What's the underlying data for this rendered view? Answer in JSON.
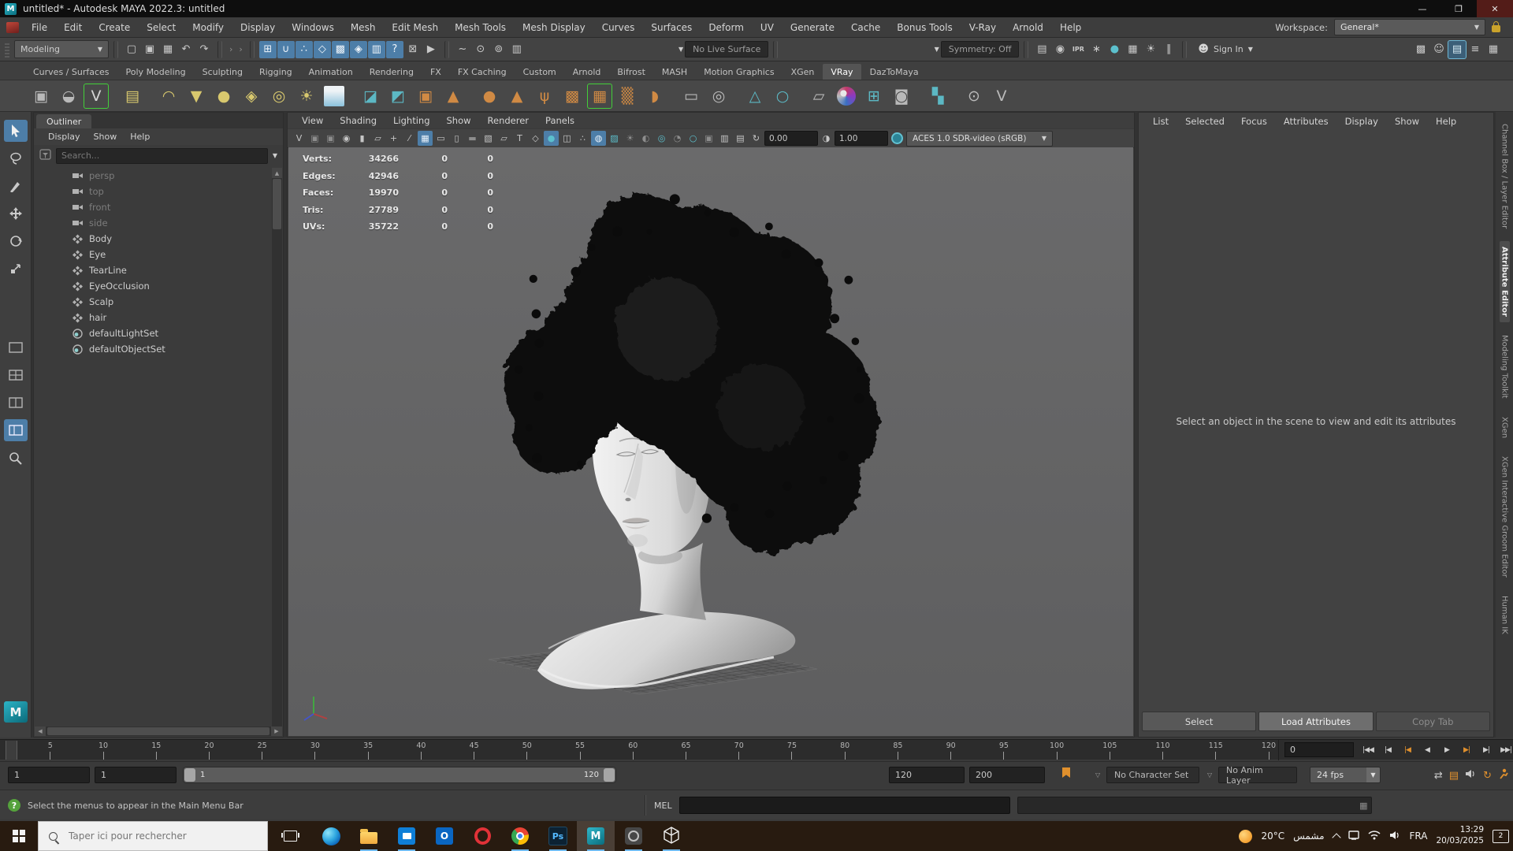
{
  "colors": {
    "highlight": "#4d7ea8",
    "accent_orange": "#e0902d",
    "teal": "#5cc0cd",
    "shelf_yellow": "#d8c86e",
    "shelf_orange": "#d08a44",
    "icon_gray": "#b9b9b9",
    "viewport_bg": "#646464"
  },
  "window": {
    "title": "untitled* - Autodesk MAYA 2022.3: untitled",
    "logo_letter": "M",
    "minimize_glyph": "—",
    "maximize_glyph": "❐",
    "close_glyph": "✕"
  },
  "menubar": {
    "items": [
      {
        "label": "File"
      },
      {
        "label": "Edit"
      },
      {
        "label": "Create"
      },
      {
        "label": "Select"
      },
      {
        "label": "Modify"
      },
      {
        "label": "Display"
      },
      {
        "label": "Windows"
      },
      {
        "label": "Mesh"
      },
      {
        "label": "Edit Mesh"
      },
      {
        "label": "Mesh Tools"
      },
      {
        "label": "Mesh Display"
      },
      {
        "label": "Curves"
      },
      {
        "label": "Surfaces"
      },
      {
        "label": "Deform"
      },
      {
        "label": "UV"
      },
      {
        "label": "Generate"
      },
      {
        "label": "Cache"
      },
      {
        "label": "Bonus Tools"
      },
      {
        "label": "V-Ray"
      },
      {
        "label": "Arnold"
      },
      {
        "label": "Help"
      }
    ],
    "workspace_label": "Workspace:",
    "workspace_value": "General*"
  },
  "statusline": {
    "mode": "Modeling",
    "file_icons": [
      {
        "name": "new-scene-icon",
        "glyph": "▢"
      },
      {
        "name": "open-scene-icon",
        "glyph": "▣"
      },
      {
        "name": "save-scene-icon",
        "glyph": "▦"
      },
      {
        "name": "undo-icon",
        "glyph": "↶"
      },
      {
        "name": "redo-icon",
        "glyph": "↷"
      }
    ],
    "snap_icons": [
      {
        "name": "snap-grid-icon",
        "glyph": "⊞",
        "cls": "hl"
      },
      {
        "name": "snap-curve-icon",
        "glyph": "∪",
        "cls": "hl"
      },
      {
        "name": "snap-point-icon",
        "glyph": "∴",
        "cls": "hl"
      },
      {
        "name": "snap-projected-center-icon",
        "glyph": "◇",
        "cls": "hl"
      },
      {
        "name": "snap-view-plane-icon",
        "glyph": "▩",
        "cls": "hl"
      },
      {
        "name": "make-live-icon",
        "glyph": "◈",
        "cls": "hl"
      },
      {
        "name": "snap-magnet-icon",
        "glyph": "▥",
        "cls": "hl"
      },
      {
        "name": "snap-help-icon",
        "glyph": "?",
        "cls": "hl"
      },
      {
        "name": "modeling-lock-icon",
        "glyph": "⊠"
      },
      {
        "name": "highlight-selection-icon",
        "glyph": "▶"
      }
    ],
    "history_icons": [
      {
        "name": "input-operations-icon",
        "glyph": "~"
      },
      {
        "name": "output-operations-icon",
        "glyph": "⊙"
      },
      {
        "name": "construction-history-icon",
        "glyph": "⊚"
      },
      {
        "name": "history-list-icon",
        "glyph": "▥"
      }
    ],
    "no_live_surface": "No Live Surface",
    "symmetry": "Symmetry: Off",
    "render_icons": [
      {
        "name": "open-render-view-icon",
        "glyph": "▤"
      },
      {
        "name": "render-current-frame-icon",
        "glyph": "◉"
      },
      {
        "name": "ipr-render-icon",
        "glyph": "IPR",
        "cls": "small"
      },
      {
        "name": "render-settings-icon",
        "glyph": "∗"
      },
      {
        "name": "toon-shading-icon",
        "glyph": "●",
        "cls": "teal"
      },
      {
        "name": "render-setup-icon",
        "glyph": "▦"
      },
      {
        "name": "light-editor-icon",
        "glyph": "☀"
      },
      {
        "name": "pause-viewport-icon",
        "glyph": "∥"
      }
    ],
    "sign_in": "Sign In",
    "sidebar_icons": [
      {
        "name": "modeling-toolkit-toggle-icon",
        "glyph": "▩"
      },
      {
        "name": "character-controls-toggle-icon",
        "glyph": "☺"
      },
      {
        "name": "attribute-editor-toggle-icon",
        "glyph": "▤",
        "cls": "hl2"
      },
      {
        "name": "tool-settings-toggle-icon",
        "glyph": "≡"
      },
      {
        "name": "channel-box-toggle-icon",
        "glyph": "▦"
      }
    ]
  },
  "shelf": {
    "mini_icons": [
      {
        "name": "shelf-menu-icon",
        "glyph": "▾"
      },
      {
        "name": "shelf-list-icon",
        "glyph": "≡"
      }
    ],
    "tabs": [
      {
        "label": "Curves / Surfaces"
      },
      {
        "label": "Poly Modeling"
      },
      {
        "label": "Sculpting"
      },
      {
        "label": "Rigging"
      },
      {
        "label": "Animation"
      },
      {
        "label": "Rendering"
      },
      {
        "label": "FX"
      },
      {
        "label": "FX Caching"
      },
      {
        "label": "Custom"
      },
      {
        "label": "Arnold"
      },
      {
        "label": "Bifrost"
      },
      {
        "label": "MASH"
      },
      {
        "label": "Motion Graphics"
      },
      {
        "label": "XGen"
      },
      {
        "label": "VRay",
        "cls": "active"
      },
      {
        "label": "DazToMaya"
      }
    ],
    "icons": [
      {
        "name": "vray-render-settings-icon",
        "glyph": "▣",
        "color": "#b9b9b9"
      },
      {
        "name": "vray-rt-icon",
        "glyph": "◒",
        "color": "#b9b9b9"
      },
      {
        "name": "vray-logo-icon",
        "glyph": "V",
        "color": "#d5d5d5",
        "cls": "sel"
      },
      {
        "name": "vray-light-lister-icon",
        "glyph": "▤",
        "color": "#d8c86e",
        "cls": "gap"
      },
      {
        "name": "vray-dome-light-icon",
        "glyph": "◠",
        "color": "#d8c86e",
        "cls": "gap"
      },
      {
        "name": "vray-rect-light-icon",
        "glyph": "▼",
        "color": "#d8c86e"
      },
      {
        "name": "vray-sphere-light-icon",
        "glyph": "●",
        "color": "#d8c86e"
      },
      {
        "name": "vray-geo-light-icon",
        "glyph": "◈",
        "color": "#d8c86e"
      },
      {
        "name": "vray-mesh-light-icon",
        "glyph": "◎",
        "color": "#d8c86e"
      },
      {
        "name": "vray-sun-light-icon",
        "glyph": "☀",
        "color": "#d8c86e"
      },
      {
        "name": "vray-sky-icon",
        "glyph": "",
        "color": "#ffffff",
        "cls": "sky gap"
      },
      {
        "name": "vray-proxy-import-icon",
        "glyph": "◪",
        "color": "#5cb8c4",
        "cls": "gap"
      },
      {
        "name": "vray-proxy-export-icon",
        "glyph": "◩",
        "color": "#5cb8c4"
      },
      {
        "name": "vray-mesh-shield-icon",
        "glyph": "▣",
        "color": "#d08a44"
      },
      {
        "name": "vray-volume-grid-icon",
        "glyph": "▲",
        "color": "#d08a44"
      },
      {
        "name": "vray-fur-ball-icon",
        "glyph": "●",
        "color": "#d08a44",
        "cls": "gap"
      },
      {
        "name": "vray-displacement-icon",
        "glyph": "▲",
        "color": "#d08a44"
      },
      {
        "name": "vray-fur-grass-icon",
        "glyph": "ψ",
        "color": "#d08a44"
      },
      {
        "name": "vray-cloth-icon",
        "glyph": "▩",
        "color": "#d08a44"
      },
      {
        "name": "vray-lattice-icon",
        "glyph": "▦",
        "color": "#d08a44",
        "cls": "sel2"
      },
      {
        "name": "vray-scatter-icon",
        "glyph": "▒",
        "color": "#d08a44"
      },
      {
        "name": "vray-clipped-sphere-icon",
        "glyph": "◗",
        "color": "#d08a44"
      },
      {
        "name": "vray-clipper-icon",
        "glyph": "▭",
        "color": "#b9b9b9",
        "cls": "gap"
      },
      {
        "name": "vray-scene-gear-icon",
        "glyph": "◎",
        "color": "#b9b9b9"
      },
      {
        "name": "vray-light-select-icon",
        "glyph": "△",
        "color": "#5cb8c4",
        "cls": "gap"
      },
      {
        "name": "vray-object-select-icon",
        "glyph": "○",
        "color": "#5cb8c4"
      },
      {
        "name": "vray-page-convert-icon",
        "glyph": "▱",
        "color": "#b9b9b9",
        "cls": "gap"
      },
      {
        "name": "vray-material-ball-icon",
        "glyph": "",
        "color": "#cccccc",
        "cls": "matball"
      },
      {
        "name": "vray-four-dots-icon",
        "glyph": "⊞",
        "color": "#5cb8c4"
      },
      {
        "name": "vray-palette-icon",
        "glyph": "◙",
        "color": "#b9b9b9"
      },
      {
        "name": "vray-checker-icon",
        "glyph": "▚",
        "color": "#5cb8c4",
        "cls": "gap"
      },
      {
        "name": "vray-plugin-icon",
        "glyph": "⊙",
        "color": "#b9b9b9",
        "cls": "gap"
      },
      {
        "name": "vray-logo-gray-icon",
        "glyph": "V",
        "color": "#b9b9b9"
      }
    ]
  },
  "outliner": {
    "tab": "Outliner",
    "menus": [
      {
        "label": "Display"
      },
      {
        "label": "Show"
      },
      {
        "label": "Help"
      }
    ],
    "search_placeholder": "Search...",
    "items": [
      {
        "label": "persp",
        "cls": "camera dim"
      },
      {
        "label": "top",
        "cls": "camera dim"
      },
      {
        "label": "front",
        "cls": "camera dim"
      },
      {
        "label": "side",
        "cls": "camera dim"
      },
      {
        "label": "Body",
        "cls": "mesh"
      },
      {
        "label": "Eye",
        "cls": "mesh"
      },
      {
        "label": "TearLine",
        "cls": "mesh"
      },
      {
        "label": "EyeOcclusion",
        "cls": "mesh"
      },
      {
        "label": "Scalp",
        "cls": "mesh"
      },
      {
        "label": "hair",
        "cls": "mesh"
      },
      {
        "label": "defaultLightSet",
        "cls": "set"
      },
      {
        "label": "defaultObjectSet",
        "cls": "set"
      }
    ]
  },
  "viewport": {
    "menus": [
      {
        "label": "View"
      },
      {
        "label": "Shading"
      },
      {
        "label": "Lighting"
      },
      {
        "label": "Show"
      },
      {
        "label": "Renderer"
      },
      {
        "label": "Panels"
      }
    ],
    "icons": [
      {
        "name": "vray-viewport-icon",
        "glyph": "V"
      },
      {
        "name": "select-camera-icon",
        "glyph": "▣",
        "cls": "dim"
      },
      {
        "name": "lock-camera-icon",
        "glyph": "▣",
        "cls": "dim"
      },
      {
        "name": "camera-attributes-icon",
        "glyph": "◉"
      },
      {
        "name": "bookmark-view-icon",
        "glyph": "▮"
      },
      {
        "name": "image-plane-icon",
        "glyph": "▱"
      },
      {
        "name": "pan-zoom-2d-icon",
        "glyph": "+"
      },
      {
        "name": "grease-pencil-icon",
        "glyph": "⁄"
      },
      {
        "name": "grid-toggle-icon",
        "glyph": "▦",
        "cls": "hl"
      },
      {
        "name": "film-gate-icon",
        "glyph": "▭"
      },
      {
        "name": "resolution-gate-icon",
        "glyph": "▯"
      },
      {
        "name": "gate-mask-icon",
        "glyph": "▬",
        "cls": "dim"
      },
      {
        "name": "field-chart-icon",
        "glyph": "▧"
      },
      {
        "name": "safe-action-icon",
        "glyph": "▱"
      },
      {
        "name": "safe-title-icon",
        "glyph": "T"
      },
      {
        "name": "wireframe-mode-icon",
        "glyph": "◇"
      },
      {
        "name": "smooth-shade-icon",
        "glyph": "●",
        "cls": "hl teal"
      },
      {
        "name": "bounding-box-icon",
        "glyph": "◫"
      },
      {
        "name": "points-mode-icon",
        "glyph": "∴"
      },
      {
        "name": "wireframe-on-shaded-icon",
        "glyph": "◍",
        "cls": "hl"
      },
      {
        "name": "textured-mode-icon",
        "glyph": "▨",
        "cls": "teal"
      },
      {
        "name": "use-all-lights-icon",
        "glyph": "☀",
        "cls": "dim"
      },
      {
        "name": "shadows-icon",
        "glyph": "◐",
        "cls": "dim"
      },
      {
        "name": "ambient-occlusion-icon",
        "glyph": "◎",
        "cls": "teal"
      },
      {
        "name": "motion-blur-icon",
        "glyph": "◔",
        "cls": "dim"
      },
      {
        "name": "multisample-icon",
        "glyph": "○",
        "cls": "teal"
      },
      {
        "name": "isolate-select-icon",
        "glyph": "▣",
        "cls": "dim"
      },
      {
        "name": "xray-mode-icon",
        "glyph": "▥"
      },
      {
        "name": "joints-xray-icon",
        "glyph": "▤"
      },
      {
        "name": "exposure-refresh-icon",
        "glyph": "↻"
      }
    ],
    "exposure": "0.00",
    "gamma": "1.00",
    "gamma_icon_name": "gamma-icon",
    "colorspace": "ACES 1.0 SDR-video (sRGB)",
    "hud": {
      "rows": [
        {
          "label": "Verts:",
          "v1": "34266",
          "v2": "0",
          "v3": "0"
        },
        {
          "label": "Edges:",
          "v1": "42946",
          "v2": "0",
          "v3": "0"
        },
        {
          "label": "Faces:",
          "v1": "19970",
          "v2": "0",
          "v3": "0"
        },
        {
          "label": "Tris:",
          "v1": "27789",
          "v2": "0",
          "v3": "0"
        },
        {
          "label": "UVs:",
          "v1": "35722",
          "v2": "0",
          "v3": "0"
        }
      ]
    }
  },
  "attribute_editor": {
    "menus": [
      {
        "label": "List"
      },
      {
        "label": "Selected"
      },
      {
        "label": "Focus"
      },
      {
        "label": "Attributes"
      },
      {
        "label": "Display"
      },
      {
        "label": "Show"
      },
      {
        "label": "Help"
      }
    ],
    "empty_message": "Select an object in the scene to view and edit its attributes",
    "buttons": [
      {
        "label": "Select"
      },
      {
        "label": "Load Attributes",
        "cls": "focus"
      },
      {
        "label": "Copy Tab",
        "cls": "dim"
      }
    ]
  },
  "right_tabs": [
    {
      "label": "Channel Box / Layer Editor"
    },
    {
      "label": "Attribute Editor",
      "cls": "active"
    },
    {
      "label": "Modeling Toolkit"
    },
    {
      "label": "XGen"
    },
    {
      "label": "XGen Interactive Groom Editor"
    },
    {
      "label": "Human IK"
    }
  ],
  "timeline": {
    "ticks": [
      5,
      10,
      15,
      20,
      25,
      30,
      35,
      40,
      45,
      50,
      55,
      60,
      65,
      70,
      75,
      80,
      85,
      90,
      95,
      100,
      105,
      110,
      115,
      120
    ],
    "current_frame": "0",
    "playback": [
      {
        "name": "go-to-start-button",
        "glyph": "|◀◀"
      },
      {
        "name": "step-back-frame-button",
        "glyph": "|◀"
      },
      {
        "name": "step-back-key-button",
        "glyph": "|◀",
        "cls": "orange"
      },
      {
        "name": "play-backwards-button",
        "glyph": "◀"
      },
      {
        "name": "play-forwards-button",
        "glyph": "▶"
      },
      {
        "name": "step-forward-key-button",
        "glyph": "▶|",
        "cls": "orange"
      },
      {
        "name": "step-forward-frame-button",
        "glyph": "▶|"
      },
      {
        "name": "go-to-end-button",
        "glyph": "▶▶|"
      }
    ],
    "range_start": "1",
    "range_start_alt": "1",
    "range_inner_start": "1",
    "range_inner_end": "120",
    "playback_end": "120",
    "animation_end": "200",
    "character_set": "No Character Set",
    "anim_layer": "No Anim Layer",
    "fps": "24 fps"
  },
  "command_line": {
    "mel_label": "MEL"
  },
  "help_line": {
    "text": "Select the menus to appear in the Main Menu Bar"
  },
  "taskbar": {
    "search_placeholder": "Taper ici pour rechercher",
    "outlook_letter": "O",
    "ps_letter": "Ps",
    "maya_letter": "M",
    "tray": {
      "temperature": "20°C",
      "weather_text": "مشمس",
      "language": "FRA",
      "time": "13:29",
      "date": "20/03/2025",
      "notification_count": "2"
    }
  }
}
